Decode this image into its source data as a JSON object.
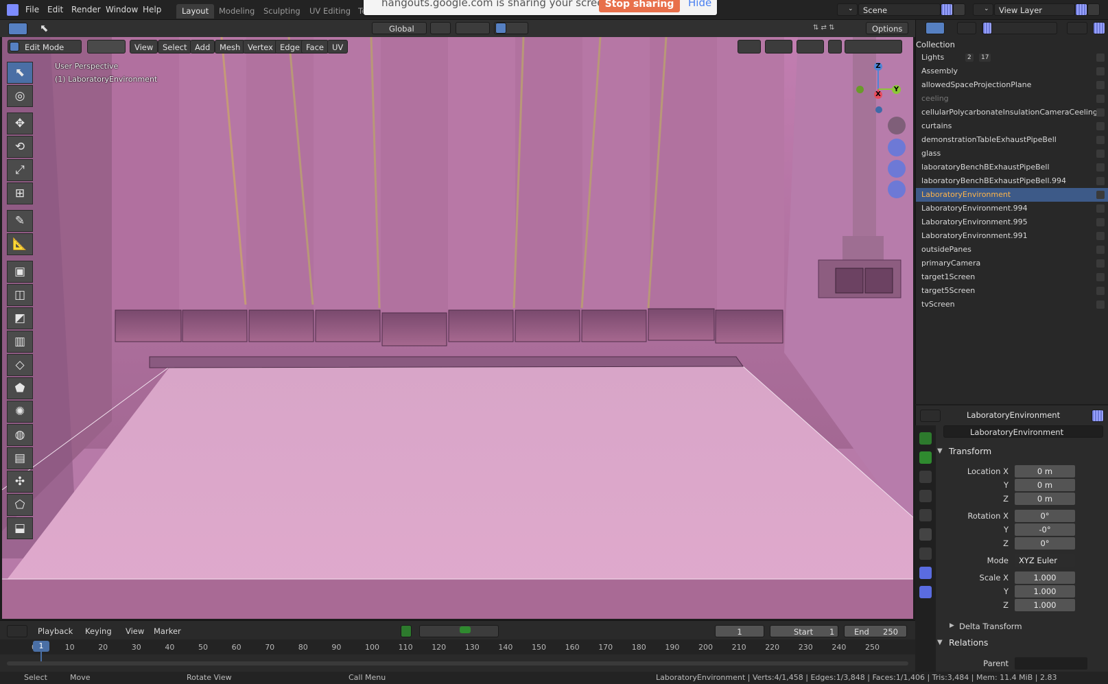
{
  "menu": [
    "File",
    "Edit",
    "Render",
    "Window",
    "Help"
  ],
  "workspace_tabs": [
    {
      "label": "Layout",
      "active": true
    },
    {
      "label": "Modeling",
      "active": false
    },
    {
      "label": "Sculpting",
      "active": false
    },
    {
      "label": "UV Editing",
      "active": false
    },
    {
      "label": "Te",
      "active": false
    }
  ],
  "share_banner": {
    "text": "hangouts.google.com is sharing your screen.",
    "stop_label": "Stop sharing",
    "hide_label": "Hide"
  },
  "scene": {
    "label": "Scene"
  },
  "view_layer": {
    "label": "View Layer"
  },
  "header2": {
    "transform_orientation": "Global",
    "options_label": "Options"
  },
  "viewport_header": {
    "mode": "Edit Mode",
    "menus": [
      "View",
      "Select",
      "Add",
      "Mesh",
      "Vertex",
      "Edge",
      "Face",
      "UV"
    ]
  },
  "viewport_overlay": {
    "perspective": "User Perspective",
    "object_label": "(1) LaboratoryEnvironment"
  },
  "gizmo": {
    "x": "X",
    "y": "Y",
    "z": "Z"
  },
  "colors": {
    "accent": "#4a6fa5",
    "selected_row": "#3d5a88",
    "selected_text": "#ffb54a",
    "viewport": "#b77aa8",
    "stop_sharing": "#e8704b"
  },
  "outliner": {
    "header": "Collection",
    "items": [
      {
        "label": "Lights",
        "badges": [
          "2",
          "17"
        ],
        "selected": false,
        "dim": false
      },
      {
        "label": "Assembly",
        "selected": false,
        "dim": false
      },
      {
        "label": "allowedSpaceProjectionPlane",
        "selected": false,
        "dim": false
      },
      {
        "label": "ceeling",
        "selected": false,
        "dim": true
      },
      {
        "label": "cellularPolycarbonateInsulationCameraCeeling",
        "selected": false,
        "dim": false
      },
      {
        "label": "curtains",
        "selected": false,
        "dim": false
      },
      {
        "label": "demonstrationTableExhaustPipeBell",
        "selected": false,
        "dim": false
      },
      {
        "label": "glass",
        "selected": false,
        "dim": false
      },
      {
        "label": "laboratoryBenchBExhaustPipeBell",
        "selected": false,
        "dim": false
      },
      {
        "label": "laboratoryBenchBExhaustPipeBell.994",
        "selected": false,
        "dim": false
      },
      {
        "label": "LaboratoryEnvironment",
        "selected": true,
        "dim": false
      },
      {
        "label": "LaboratoryEnvironment.994",
        "selected": false,
        "dim": false
      },
      {
        "label": "LaboratoryEnvironment.995",
        "selected": false,
        "dim": false
      },
      {
        "label": "LaboratoryEnvironment.991",
        "selected": false,
        "dim": false
      },
      {
        "label": "outsidePanes",
        "selected": false,
        "dim": false
      },
      {
        "label": "primaryCamera",
        "selected": false,
        "dim": false
      },
      {
        "label": "target1Screen",
        "selected": false,
        "dim": false
      },
      {
        "label": "target5Screen",
        "selected": false,
        "dim": false
      },
      {
        "label": "tvScreen",
        "selected": false,
        "dim": false
      }
    ]
  },
  "properties": {
    "object_name": "LaboratoryEnvironment",
    "data_name": "LaboratoryEnvironment",
    "transform": {
      "title": "Transform",
      "location_label": "Location X",
      "location": [
        "0 m",
        "0 m",
        "0 m"
      ],
      "rotation_label": "Rotation X",
      "rotation": [
        "0°",
        "-0°",
        "0°"
      ],
      "mode_label": "Mode",
      "mode": "XYZ Euler",
      "scale_label": "Scale X",
      "scale": [
        "1.000",
        "1.000",
        "1.000"
      ],
      "axis_y": "Y",
      "axis_z": "Z"
    },
    "delta_transform": "Delta Transform",
    "relations": "Relations",
    "parent_label": "Parent"
  },
  "timeline": {
    "menus": [
      "Playback",
      "Keying",
      "View",
      "Marker"
    ],
    "current_frame": "1",
    "start_label": "Start",
    "start_value": "1",
    "end_label": "End",
    "end_value": "250",
    "ruler": [
      "0",
      "10",
      "20",
      "30",
      "40",
      "50",
      "60",
      "70",
      "80",
      "90",
      "100",
      "110",
      "120",
      "130",
      "140",
      "150",
      "160",
      "170",
      "180",
      "190",
      "200",
      "210",
      "220",
      "230",
      "240",
      "250"
    ]
  },
  "statusbar": {
    "select": "Select",
    "move": "Move",
    "rotate": "Rotate View",
    "call_menu": "Call Menu",
    "stats": "LaboratoryEnvironment | Verts:4/1,458 | Edges:1/3,848 | Faces:1/1,406 | Tris:3,484 | Mem: 11.4 MiB | 2.83"
  }
}
